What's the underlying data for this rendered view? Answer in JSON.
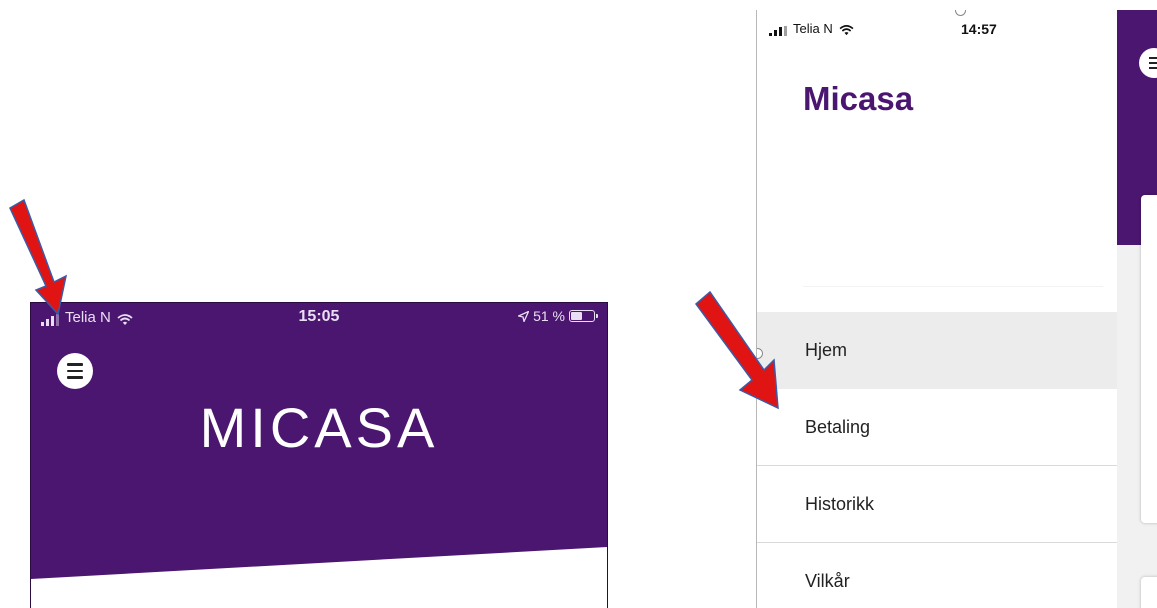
{
  "left_phone": {
    "carrier": "Telia N",
    "time": "15:05",
    "battery": "51 %",
    "battery_level": 0.51,
    "logo": "MICASA"
  },
  "right_phone": {
    "carrier": "Telia N",
    "time": "14:57",
    "brand": "Micasa",
    "nav": {
      "items": [
        {
          "label": "Hjem",
          "active": true
        },
        {
          "label": "Betaling",
          "active": false
        },
        {
          "label": "Historikk",
          "active": false
        },
        {
          "label": "Vilkår",
          "active": false
        }
      ]
    }
  },
  "colors": {
    "brand_purple": "#4b1670",
    "annotation_arrow": "#e11414",
    "arrow_outline": "#3a5ba8"
  },
  "icons": [
    "cellular-signal-icon",
    "wifi-icon",
    "location-arrow-icon",
    "battery-icon",
    "hamburger-menu-icon"
  ]
}
